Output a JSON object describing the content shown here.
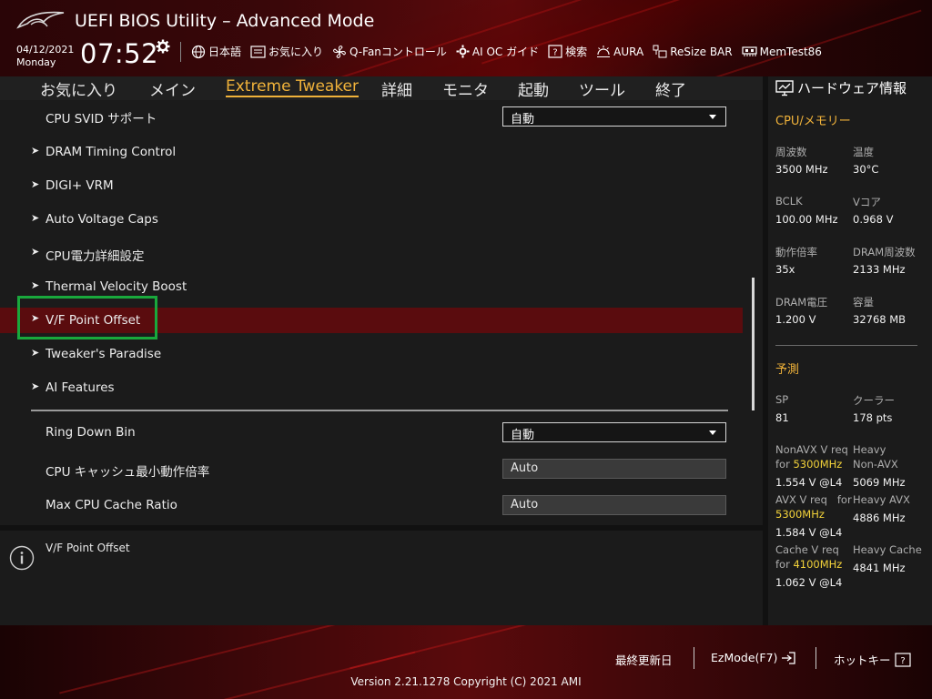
{
  "header": {
    "title": "UEFI BIOS Utility – Advanced Mode",
    "date": "04/12/2021",
    "day": "Monday",
    "time": "07:52",
    "tools": [
      {
        "label": "日本語",
        "icon": "globe-icon"
      },
      {
        "label": "お気に入り",
        "icon": "favorites-icon"
      },
      {
        "label": "Q-Fanコントロール",
        "icon": "fan-icon"
      },
      {
        "label": "AI OC ガイド",
        "icon": "ai-oc-icon"
      },
      {
        "label": "検索",
        "icon": "help-search-icon"
      },
      {
        "label": "AURA",
        "icon": "aura-icon"
      },
      {
        "label": "ReSize BAR",
        "icon": "resize-bar-icon"
      },
      {
        "label": "MemTest86",
        "icon": "memtest-icon"
      }
    ]
  },
  "tabs": [
    {
      "label": "お気に入り",
      "active": false
    },
    {
      "label": "メイン",
      "active": false
    },
    {
      "label": "Extreme Tweaker",
      "active": true
    },
    {
      "label": "詳細",
      "active": false
    },
    {
      "label": "モニタ",
      "active": false
    },
    {
      "label": "起動",
      "active": false
    },
    {
      "label": "ツール",
      "active": false
    },
    {
      "label": "終了",
      "active": false
    }
  ],
  "settings": {
    "svid": {
      "label": "CPU SVID サポート",
      "value": "自動"
    },
    "submenus": [
      "DRAM Timing Control",
      "DIGI+ VRM",
      "Auto Voltage Caps",
      "CPU電力詳細設定",
      "Thermal Velocity Boost",
      "V/F Point Offset",
      "Tweaker's Paradise",
      "AI Features"
    ],
    "ring_down_bin": {
      "label": "Ring Down Bin",
      "value": "自動"
    },
    "cache_min": {
      "label": "CPU キャッシュ最小動作倍率",
      "value": "Auto"
    },
    "cache_max": {
      "label": "Max CPU Cache Ratio",
      "value": "Auto"
    }
  },
  "help": {
    "text": "V/F Point Offset"
  },
  "hardware": {
    "title": "ハードウェア情報",
    "cpu_mem_title": "CPU/メモリー",
    "freq_label": "周波数",
    "freq_value": "3500 MHz",
    "temp_label": "温度",
    "temp_value": "30°C",
    "bclk_label": "BCLK",
    "bclk_value": "100.00 MHz",
    "vcore_label": "Vコア",
    "vcore_value": "0.968 V",
    "ratio_label": "動作倍率",
    "ratio_value": "35x",
    "dram_freq_label": "DRAM周波数",
    "dram_freq_value": "2133 MHz",
    "dram_volt_label": "DRAM電圧",
    "dram_volt_value": "1.200 V",
    "capacity_label": "容量",
    "capacity_value": "32768 MB",
    "predict_title": "予測",
    "sp_label": "SP",
    "sp_value": "81",
    "cooler_label": "クーラー",
    "cooler_value": "178 pts",
    "nonavx_label1": "NonAVX V req",
    "nonavx_for": "for",
    "nonavx_freq": "5300MHz",
    "nonavx_value": "1.554 V @L4",
    "heavy_nonavx_label1": "Heavy",
    "heavy_nonavx_label2": "Non-AVX",
    "heavy_nonavx_value": "5069 MHz",
    "avx_label1": "AVX V req",
    "avx_for": "for",
    "avx_freq": "5300MHz",
    "avx_value": "1.584 V @L4",
    "heavy_avx_label": "Heavy AVX",
    "heavy_avx_value": "4886 MHz",
    "cache_label1": "Cache V req",
    "cache_for": "for",
    "cache_freq": "4100MHz",
    "cache_value": "1.062 V @L4",
    "heavy_cache_label": "Heavy Cache",
    "heavy_cache_value": "4841 MHz"
  },
  "footer": {
    "last_modified": "最終更新日",
    "ezmode": "EzMode(F7)",
    "hotkey": "ホットキー",
    "version": "Version 2.21.1278 Copyright (C) 2021 AMI"
  },
  "colors": {
    "accent": "#f0b23a",
    "selection": "#5a0c0e",
    "highlight_box": "#19a83c",
    "predict_highlight": "#f2d23a"
  }
}
